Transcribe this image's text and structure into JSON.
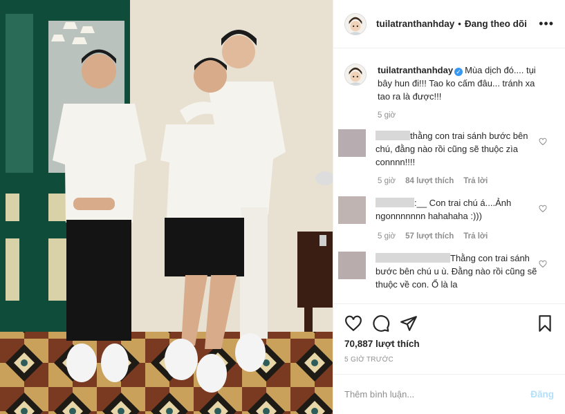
{
  "header": {
    "username": "tuilatranthanhday",
    "separator": "•",
    "follow_status": "Đang theo dõi",
    "more": "•••"
  },
  "caption": {
    "username": "tuilatranthanhday",
    "text": "Mùa dịch đó.... tụi bây hun đi!!! Tao ko cấm đâu... tránh xa tao ra là được!!!",
    "time": "5 giờ"
  },
  "comments": [
    {
      "text": "thằng con trai sánh bước bên chú, đằng nào rồi cũng sẽ thuộc zìa connnn!!!!",
      "time": "5 giờ",
      "likes": "84 lượt thích",
      "reply": "Trả lời"
    },
    {
      "text": ":__ Con trai chú á....Ảnh ngonnnnnnn hahahaha :)))",
      "time": "5 giờ",
      "likes": "57 lượt thích",
      "reply": "Trả lời"
    },
    {
      "text": "Thằng con trai sánh bước bên chú u ù. Đằng nào rồi cũng sẽ thuộc về con. Ổ là la"
    }
  ],
  "actions": {
    "likes": "70,887 lượt thích",
    "time_ago": "5 GIỜ TRƯỚC"
  },
  "add_comment": {
    "placeholder": "Thêm bình luận...",
    "post": "Đăng"
  },
  "colors": {
    "text": "#262626",
    "muted": "#8e8e8e",
    "verified": "#3897f0",
    "post_disabled": "#b2dffc"
  }
}
